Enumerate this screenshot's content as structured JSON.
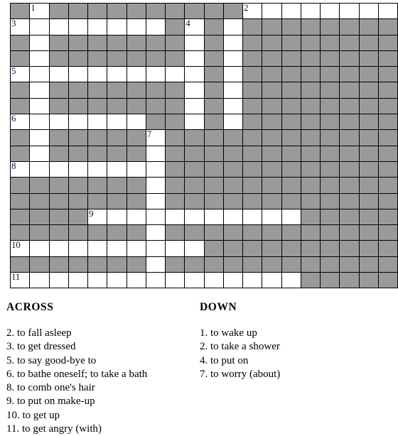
{
  "puzzle": {
    "columns": 20,
    "rows": 18,
    "colors": {
      "blocked": "#9a9a9a",
      "open": "#ffffff",
      "border": "#000000",
      "number": "#11114a"
    },
    "grid": [
      [
        "B",
        "1",
        "B",
        "B",
        "B",
        "B",
        "B",
        "B",
        "B",
        "B",
        "B",
        "B",
        "2",
        "O",
        "O",
        "O",
        "O",
        "O",
        "O",
        "O"
      ],
      [
        "3",
        "O",
        "O",
        "O",
        "O",
        "O",
        "O",
        "O",
        "B",
        "4",
        "B",
        "O",
        "B",
        "B",
        "B",
        "B",
        "B",
        "B",
        "B",
        "B"
      ],
      [
        "B",
        "O",
        "B",
        "B",
        "B",
        "B",
        "B",
        "B",
        "B",
        "O",
        "B",
        "O",
        "B",
        "B",
        "B",
        "B",
        "B",
        "B",
        "B",
        "B"
      ],
      [
        "B",
        "O",
        "B",
        "B",
        "B",
        "B",
        "B",
        "B",
        "B",
        "O",
        "B",
        "O",
        "B",
        "B",
        "B",
        "B",
        "B",
        "B",
        "B",
        "B"
      ],
      [
        "5",
        "O",
        "O",
        "O",
        "O",
        "O",
        "O",
        "O",
        "O",
        "O",
        "B",
        "O",
        "B",
        "B",
        "B",
        "B",
        "B",
        "B",
        "B",
        "B"
      ],
      [
        "B",
        "O",
        "B",
        "B",
        "B",
        "B",
        "B",
        "B",
        "B",
        "O",
        "B",
        "O",
        "B",
        "B",
        "B",
        "B",
        "B",
        "B",
        "B",
        "B"
      ],
      [
        "B",
        "O",
        "B",
        "B",
        "B",
        "B",
        "B",
        "B",
        "B",
        "O",
        "B",
        "O",
        "B",
        "B",
        "B",
        "B",
        "B",
        "B",
        "B",
        "B"
      ],
      [
        "6",
        "O",
        "O",
        "O",
        "O",
        "O",
        "O",
        "B",
        "B",
        "O",
        "B",
        "O",
        "B",
        "B",
        "B",
        "B",
        "B",
        "B",
        "B",
        "B"
      ],
      [
        "B",
        "O",
        "B",
        "B",
        "B",
        "B",
        "B",
        "7",
        "B",
        "B",
        "B",
        "B",
        "B",
        "B",
        "B",
        "B",
        "B",
        "B",
        "B",
        "B"
      ],
      [
        "B",
        "O",
        "B",
        "B",
        "B",
        "B",
        "B",
        "O",
        "B",
        "B",
        "B",
        "B",
        "B",
        "B",
        "B",
        "B",
        "B",
        "B",
        "B",
        "B"
      ],
      [
        "8",
        "O",
        "O",
        "O",
        "O",
        "O",
        "O",
        "O",
        "B",
        "B",
        "B",
        "B",
        "B",
        "B",
        "B",
        "B",
        "B",
        "B",
        "B",
        "B"
      ],
      [
        "B",
        "B",
        "B",
        "B",
        "B",
        "B",
        "B",
        "O",
        "B",
        "B",
        "B",
        "B",
        "B",
        "B",
        "B",
        "B",
        "B",
        "B",
        "B",
        "B"
      ],
      [
        "B",
        "B",
        "B",
        "B",
        "B",
        "B",
        "B",
        "O",
        "B",
        "B",
        "B",
        "B",
        "B",
        "B",
        "B",
        "B",
        "B",
        "B",
        "B",
        "B"
      ],
      [
        "B",
        "B",
        "B",
        "B",
        "9",
        "O",
        "O",
        "O",
        "O",
        "O",
        "O",
        "O",
        "O",
        "O",
        "O",
        "B",
        "B",
        "B",
        "B",
        "B"
      ],
      [
        "B",
        "B",
        "B",
        "B",
        "B",
        "B",
        "B",
        "O",
        "B",
        "B",
        "B",
        "B",
        "B",
        "B",
        "B",
        "B",
        "B",
        "B",
        "B",
        "B"
      ],
      [
        "10",
        "O",
        "O",
        "O",
        "O",
        "O",
        "O",
        "O",
        "O",
        "O",
        "B",
        "B",
        "B",
        "B",
        "B",
        "B",
        "B",
        "B",
        "B",
        "B"
      ],
      [
        "B",
        "B",
        "B",
        "B",
        "B",
        "B",
        "B",
        "O",
        "B",
        "B",
        "B",
        "B",
        "B",
        "B",
        "B",
        "B",
        "B",
        "B",
        "B",
        "B"
      ],
      [
        "11",
        "O",
        "O",
        "O",
        "O",
        "O",
        "O",
        "O",
        "O",
        "O",
        "O",
        "O",
        "O",
        "O",
        "O",
        "B",
        "B",
        "B",
        "B",
        "B"
      ]
    ]
  },
  "clues": {
    "across": {
      "heading": "ACROSS",
      "items": [
        {
          "num": "2.",
          "text": "to fall asleep"
        },
        {
          "num": "3.",
          "text": "to get dressed"
        },
        {
          "num": "5.",
          "text": "to say good-bye to"
        },
        {
          "num": "6.",
          "text": "to bathe oneself; to take a bath"
        },
        {
          "num": "8.",
          "text": "to comb one's hair"
        },
        {
          "num": "9.",
          "text": "to put on make-up"
        },
        {
          "num": "10.",
          "text": "to get up"
        },
        {
          "num": "11.",
          "text": "to get angry (with)"
        }
      ]
    },
    "down": {
      "heading": "DOWN",
      "items": [
        {
          "num": "1.",
          "text": "to wake up"
        },
        {
          "num": "2.",
          "text": "to take a shower"
        },
        {
          "num": "4.",
          "text": "to put on"
        },
        {
          "num": "7.",
          "text": "to worry (about)"
        }
      ]
    }
  }
}
